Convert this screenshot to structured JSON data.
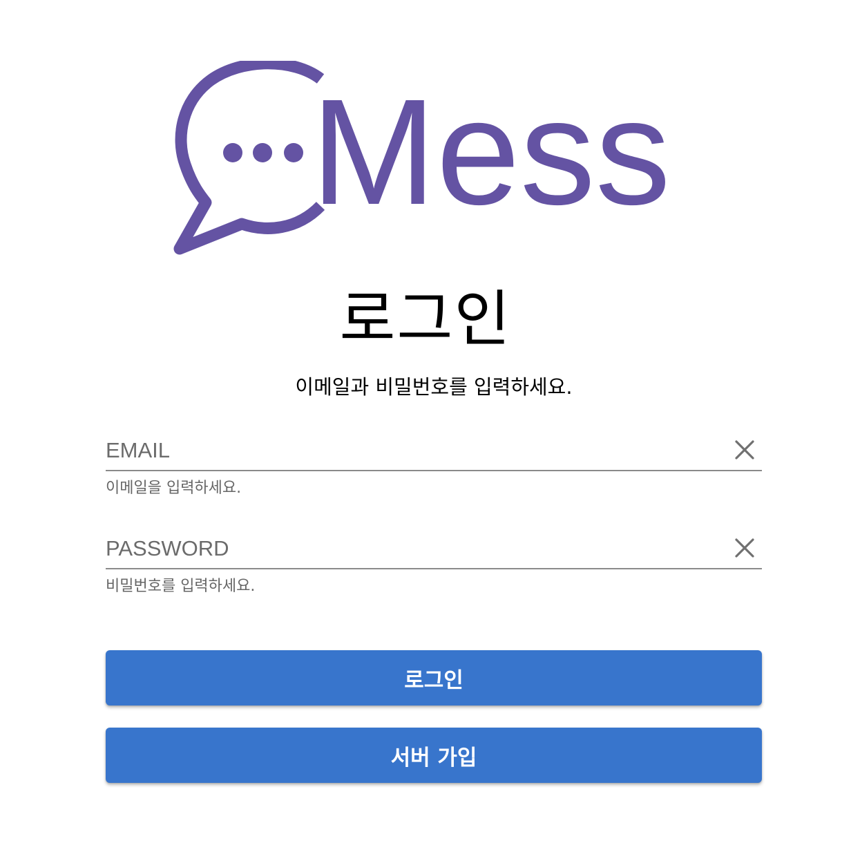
{
  "logo": {
    "icon": "chat-bubble-icon",
    "text": "Mess",
    "color": "#6453a3"
  },
  "page": {
    "title": "로그인",
    "subtitle": "이메일과 비밀번호를 입력하세요."
  },
  "email": {
    "placeholder": "EMAIL",
    "value": "",
    "helper": "이메일을 입력하세요.",
    "clear_icon": "close-icon"
  },
  "password": {
    "placeholder": "PASSWORD",
    "value": "",
    "helper": "비밀번호를 입력하세요.",
    "clear_icon": "close-icon"
  },
  "buttons": {
    "login_label": "로그인",
    "join_label": "서버 가입",
    "color": "#3875cc"
  }
}
